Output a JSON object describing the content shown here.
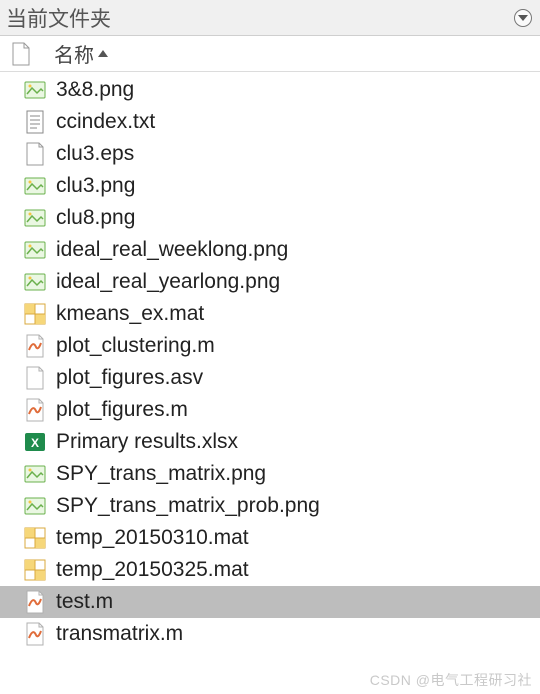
{
  "panel": {
    "title": "当前文件夹",
    "column_header": "名称"
  },
  "files": [
    {
      "name": "3&8.png",
      "type": "png",
      "selected": false
    },
    {
      "name": "ccindex.txt",
      "type": "txt",
      "selected": false
    },
    {
      "name": "clu3.eps",
      "type": "eps",
      "selected": false
    },
    {
      "name": "clu3.png",
      "type": "png",
      "selected": false
    },
    {
      "name": "clu8.png",
      "type": "png",
      "selected": false
    },
    {
      "name": "ideal_real_weeklong.png",
      "type": "png",
      "selected": false
    },
    {
      "name": "ideal_real_yearlong.png",
      "type": "png",
      "selected": false
    },
    {
      "name": "kmeans_ex.mat",
      "type": "mat",
      "selected": false
    },
    {
      "name": "plot_clustering.m",
      "type": "m",
      "selected": false
    },
    {
      "name": "plot_figures.asv",
      "type": "asv",
      "selected": false
    },
    {
      "name": "plot_figures.m",
      "type": "m",
      "selected": false
    },
    {
      "name": "Primary results.xlsx",
      "type": "xlsx",
      "selected": false
    },
    {
      "name": "SPY_trans_matrix.png",
      "type": "png",
      "selected": false
    },
    {
      "name": "SPY_trans_matrix_prob.png",
      "type": "png",
      "selected": false
    },
    {
      "name": "temp_20150310.mat",
      "type": "mat",
      "selected": false
    },
    {
      "name": "temp_20150325.mat",
      "type": "mat",
      "selected": false
    },
    {
      "name": "test.m",
      "type": "m",
      "selected": true
    },
    {
      "name": "transmatrix.m",
      "type": "m",
      "selected": false
    }
  ],
  "watermark": "CSDN @电气工程研习社"
}
